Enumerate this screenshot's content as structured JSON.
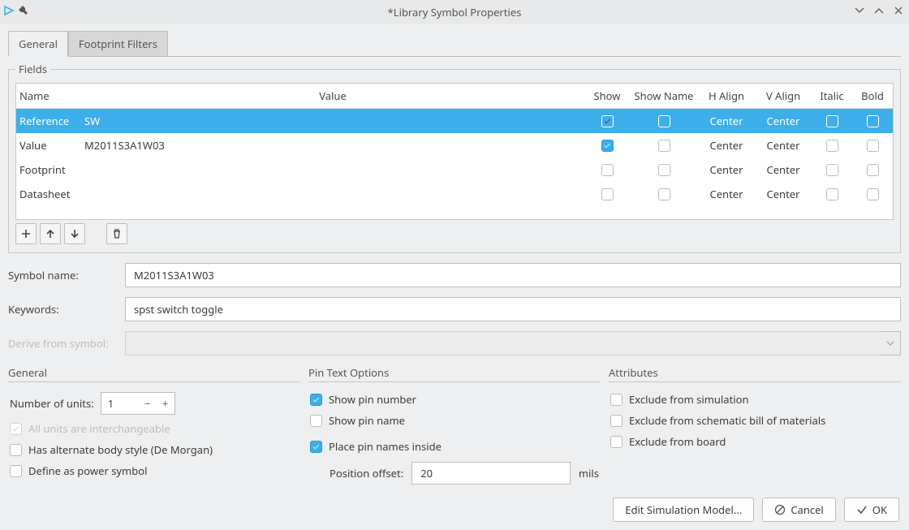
{
  "window": {
    "title": "*Library Symbol Properties"
  },
  "tabs": [
    {
      "label": "General",
      "active": true
    },
    {
      "label": "Footprint Filters",
      "active": false
    }
  ],
  "fields": {
    "legend": "Fields",
    "head": {
      "name": "Name",
      "value": "Value",
      "show": "Show",
      "showName": "Show Name",
      "hAlign": "H Align",
      "vAlign": "V Align",
      "italic": "Italic",
      "bold": "Bold"
    },
    "rows": [
      {
        "name": "Reference",
        "value": "SW",
        "show": true,
        "showName": false,
        "hAlign": "Center",
        "vAlign": "Center",
        "italic": false,
        "bold": false,
        "selected": true
      },
      {
        "name": "Value",
        "value": "M2011S3A1W03",
        "show": true,
        "showName": false,
        "hAlign": "Center",
        "vAlign": "Center",
        "italic": false,
        "bold": false,
        "selected": false
      },
      {
        "name": "Footprint",
        "value": "",
        "show": false,
        "showName": false,
        "hAlign": "Center",
        "vAlign": "Center",
        "italic": false,
        "bold": false,
        "selected": false
      },
      {
        "name": "Datasheet",
        "value": "",
        "show": false,
        "showName": false,
        "hAlign": "Center",
        "vAlign": "Center",
        "italic": false,
        "bold": false,
        "selected": false
      }
    ]
  },
  "symbol": {
    "name_label": "Symbol name:",
    "name": "M2011S3A1W03",
    "keywords_label": "Keywords:",
    "keywords": "spst switch toggle",
    "derive_label": "Derive from symbol:"
  },
  "general": {
    "title": "General",
    "units_label": "Number of units:",
    "units": "1",
    "interchangeable": "All units are interchangeable",
    "altBody": "Has alternate body style (De Morgan)",
    "powerSym": "Define as power symbol"
  },
  "pinText": {
    "title": "Pin Text Options",
    "showPinNumber": "Show pin number",
    "showPinName": "Show pin name",
    "placeInside": "Place pin names inside",
    "offset_label": "Position offset:",
    "offset": "20",
    "offset_unit": "mils"
  },
  "attributes": {
    "title": "Attributes",
    "excludeSim": "Exclude from simulation",
    "excludeBom": "Exclude from schematic bill of materials",
    "excludeBoard": "Exclude from board"
  },
  "footer": {
    "editSim": "Edit Simulation Model...",
    "cancel": "Cancel",
    "ok": "OK"
  }
}
